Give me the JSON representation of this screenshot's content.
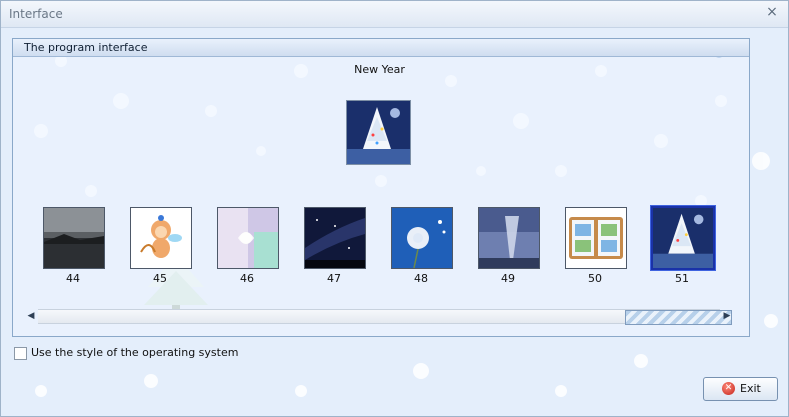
{
  "window": {
    "title": "Interface"
  },
  "panel": {
    "title": "The program interface"
  },
  "preview": {
    "theme_name": "New Year"
  },
  "thumbnails": [
    {
      "label": "44",
      "scene": "grey-lake"
    },
    {
      "label": "45",
      "scene": "cupid-monkey"
    },
    {
      "label": "46",
      "scene": "gift-box"
    },
    {
      "label": "47",
      "scene": "night-sky"
    },
    {
      "label": "48",
      "scene": "dandelion"
    },
    {
      "label": "49",
      "scene": "tornado"
    },
    {
      "label": "50",
      "scene": "photo-album"
    },
    {
      "label": "51",
      "scene": "christmas-tree",
      "selected": true
    }
  ],
  "scrollbar": {
    "left_arrow": "◀",
    "right_arrow": "▶"
  },
  "options": {
    "use_os_style": {
      "label": "Use the style of the operating system",
      "checked": false
    }
  },
  "buttons": {
    "exit": {
      "label": "Exit",
      "icon": "exit-icon"
    }
  },
  "icons": {
    "close": "×"
  }
}
